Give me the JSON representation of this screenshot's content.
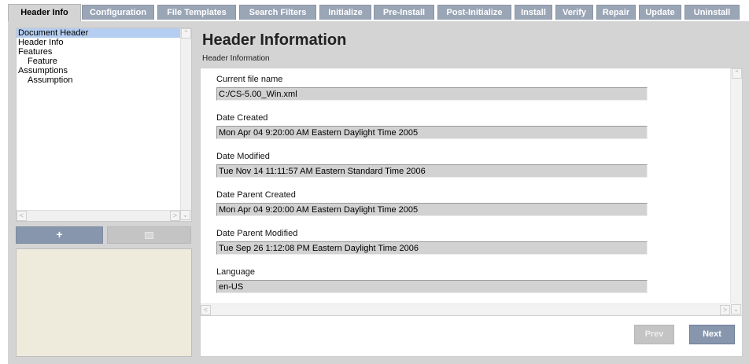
{
  "tabs": [
    {
      "label": "Header Info",
      "active": true
    },
    {
      "label": "Configuration"
    },
    {
      "label": "File Templates"
    },
    {
      "label": "Search Filters"
    },
    {
      "label": "Initialize"
    },
    {
      "label": "Pre-Install"
    },
    {
      "label": "Post-Initialize"
    },
    {
      "label": "Install"
    },
    {
      "label": "Verify"
    },
    {
      "label": "Repair"
    },
    {
      "label": "Update"
    },
    {
      "label": "Uninstall"
    }
  ],
  "tree": {
    "items": [
      {
        "label": "Document Header",
        "selected": true
      },
      {
        "label": "Header Info"
      },
      {
        "label": "Features"
      },
      {
        "label": "Feature",
        "indent": true
      },
      {
        "label": "Assumptions"
      },
      {
        "label": "Assumption",
        "indent": true
      }
    ],
    "add_label": "+",
    "remove_label": ""
  },
  "main": {
    "title": "Header Information",
    "subtitle": "Header Information",
    "fields": [
      {
        "label": "Current file name",
        "value": "C:/CS-5.00_Win.xml"
      },
      {
        "label": "Date Created",
        "value": "Mon Apr 04 9:20:00 AM Eastern Daylight Time 2005"
      },
      {
        "label": "Date Modified",
        "value": "Tue Nov 14 11:11:57 AM Eastern Standard Time 2006"
      },
      {
        "label": "Date Parent Created",
        "value": "Mon Apr 04 9:20:00 AM Eastern Daylight Time 2005"
      },
      {
        "label": "Date Parent Modified",
        "value": "Tue Sep 26 1:12:08 PM Eastern Daylight Time 2006"
      },
      {
        "label": "Language",
        "value": "en-US"
      }
    ]
  },
  "footer": {
    "prev_label": "Prev",
    "next_label": "Next"
  },
  "colors": {
    "tab_bg": "#9aa5b6",
    "tab_active_bg": "#d4d4d4",
    "frame_bg": "#d4d4d4",
    "selection": "#b4cdf0",
    "accent_button": "#8796ad",
    "disabled_button": "#c4c4c4",
    "field_bg": "#d2d2d2",
    "info_pane_bg": "#eeebdd"
  }
}
